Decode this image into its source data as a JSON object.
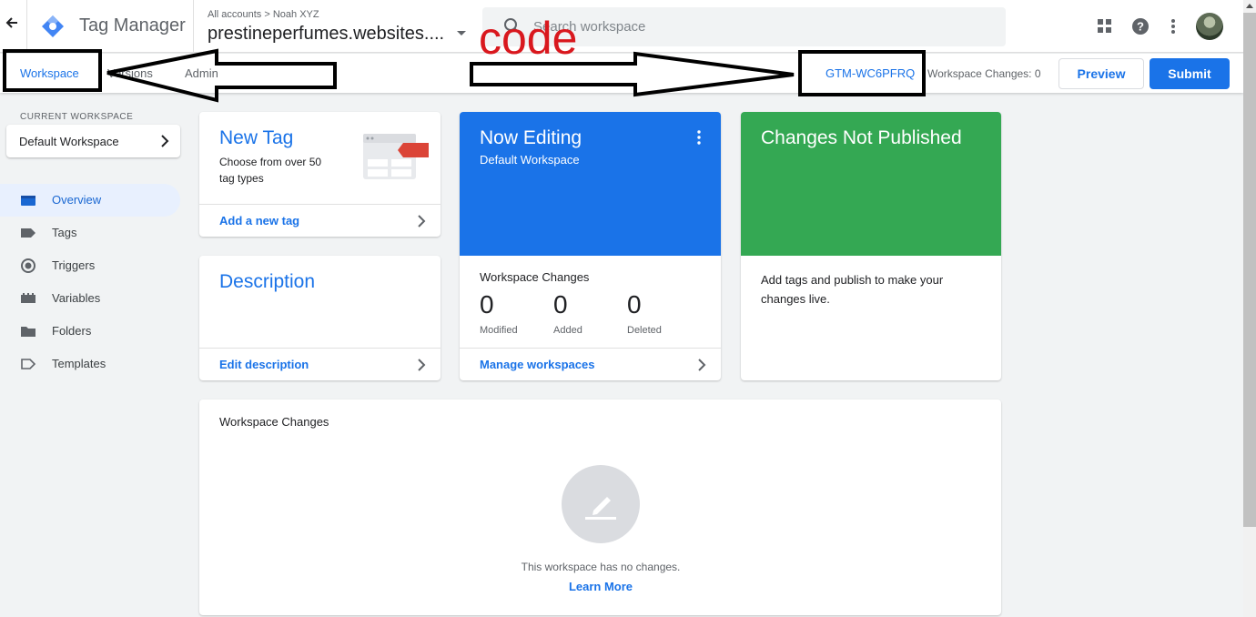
{
  "header": {
    "app_name": "Tag Manager",
    "breadcrumb": "All accounts > Noah XYZ",
    "container_name": "prestineperfumes.websites....",
    "search_placeholder": "Search workspace"
  },
  "subheader": {
    "tabs": [
      {
        "label": "Workspace"
      },
      {
        "label": "Versions"
      },
      {
        "label": "Admin"
      }
    ],
    "container_id": "GTM-WC6PFRQ",
    "workspace_changes": "Workspace Changes: 0",
    "preview_label": "Preview",
    "submit_label": "Submit"
  },
  "sidebar": {
    "current_workspace_label": "CURRENT WORKSPACE",
    "workspace_name": "Default Workspace",
    "items": [
      {
        "label": "Overview",
        "icon": "overview-icon"
      },
      {
        "label": "Tags",
        "icon": "tag-icon"
      },
      {
        "label": "Triggers",
        "icon": "trigger-icon"
      },
      {
        "label": "Variables",
        "icon": "variables-icon"
      },
      {
        "label": "Folders",
        "icon": "folder-icon"
      },
      {
        "label": "Templates",
        "icon": "template-icon"
      }
    ]
  },
  "cards": {
    "new_tag": {
      "title": "New Tag",
      "description": "Choose from over 50 tag types",
      "link": "Add a new tag"
    },
    "description": {
      "title": "Description",
      "link": "Edit description"
    },
    "now_editing": {
      "title": "Now Editing",
      "subtitle": "Default Workspace",
      "changes_label": "Workspace Changes",
      "stats": [
        {
          "value": "0",
          "label": "Modified"
        },
        {
          "value": "0",
          "label": "Added"
        },
        {
          "value": "0",
          "label": "Deleted"
        }
      ],
      "link": "Manage workspaces"
    },
    "not_published": {
      "title": "Changes Not Published",
      "text": "Add tags and publish to make your changes live."
    },
    "workspace_changes": {
      "title": "Workspace Changes",
      "empty_text": "This workspace has no changes.",
      "learn_more": "Learn More"
    }
  },
  "annotation": {
    "text": "code",
    "color": "#d9181e"
  },
  "colors": {
    "accent": "#1a73e8",
    "now_editing_bg": "#1a73e8",
    "not_published_bg": "#34a853"
  }
}
